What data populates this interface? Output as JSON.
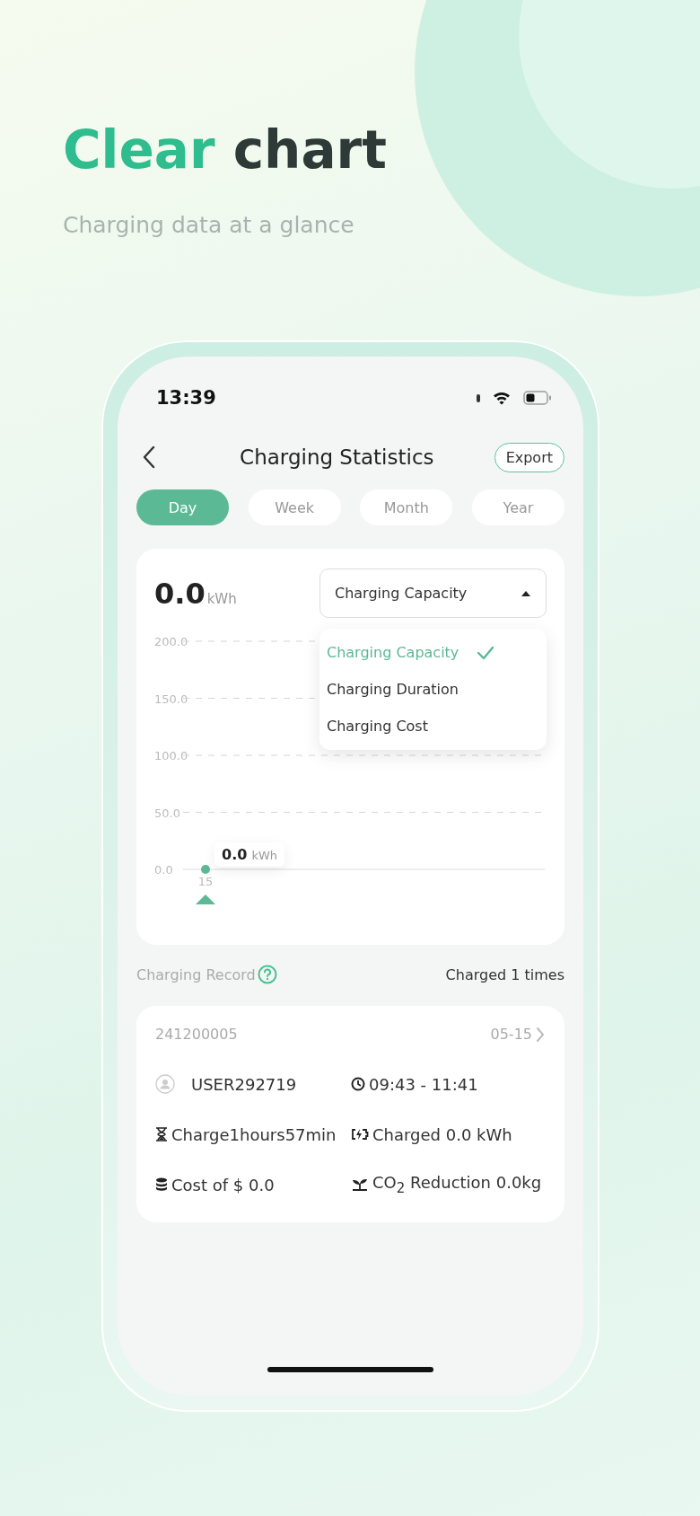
{
  "headline": {
    "accent": "Clear",
    "rest": "chart"
  },
  "subtitle": "Charging data at a glance",
  "status_bar": {
    "time": "13:39"
  },
  "header": {
    "title": "Charging Statistics",
    "action": "Export"
  },
  "tabs": [
    {
      "label": "Day",
      "selected": true
    },
    {
      "label": "Week",
      "selected": false
    },
    {
      "label": "Month",
      "selected": false
    },
    {
      "label": "Year",
      "selected": false
    }
  ],
  "summary": {
    "value": "0.0",
    "unit": "kWh"
  },
  "metric_select": {
    "value": "Charging Capacity",
    "expanded": true,
    "options": [
      {
        "label": "Charging Capacity",
        "selected": true
      },
      {
        "label": "Charging Duration",
        "selected": false
      },
      {
        "label": "Charging Cost",
        "selected": false
      }
    ]
  },
  "chart": {
    "tooltip": {
      "value": "0.0",
      "unit": "kWh"
    },
    "chart_data": {
      "type": "line",
      "grid": true,
      "categories": [
        "15"
      ],
      "series": [
        {
          "color": "#5bb996",
          "marker": true,
          "values": [
            0
          ]
        }
      ],
      "ylim": [
        0,
        200
      ],
      "yticks": [
        {
          "value": 0,
          "label": "0.0"
        },
        {
          "value": 50,
          "label": "50.0"
        },
        {
          "value": 100,
          "label": "100.0"
        },
        {
          "value": 150,
          "label": "150.0"
        },
        {
          "value": 200,
          "label": "200.0"
        }
      ]
    }
  },
  "records": {
    "title": "Charging Record",
    "count": "Charged 1 times",
    "items": [
      {
        "id": "241200005",
        "date": "05-15",
        "fields": [
          {
            "kind": "user",
            "text": "USER292719"
          },
          {
            "kind": "clock",
            "text": "09:43 - 11:41"
          },
          {
            "kind": "hourglass",
            "text": "Charge1hours57min"
          },
          {
            "kind": "battery",
            "text": "Charged 0.0 kWh"
          },
          {
            "kind": "coins",
            "text": "Cost of $ 0.0"
          },
          {
            "kind": "sprout",
            "text": "CO$_{2}$ Reduction 0.0kg"
          }
        ]
      }
    ]
  }
}
